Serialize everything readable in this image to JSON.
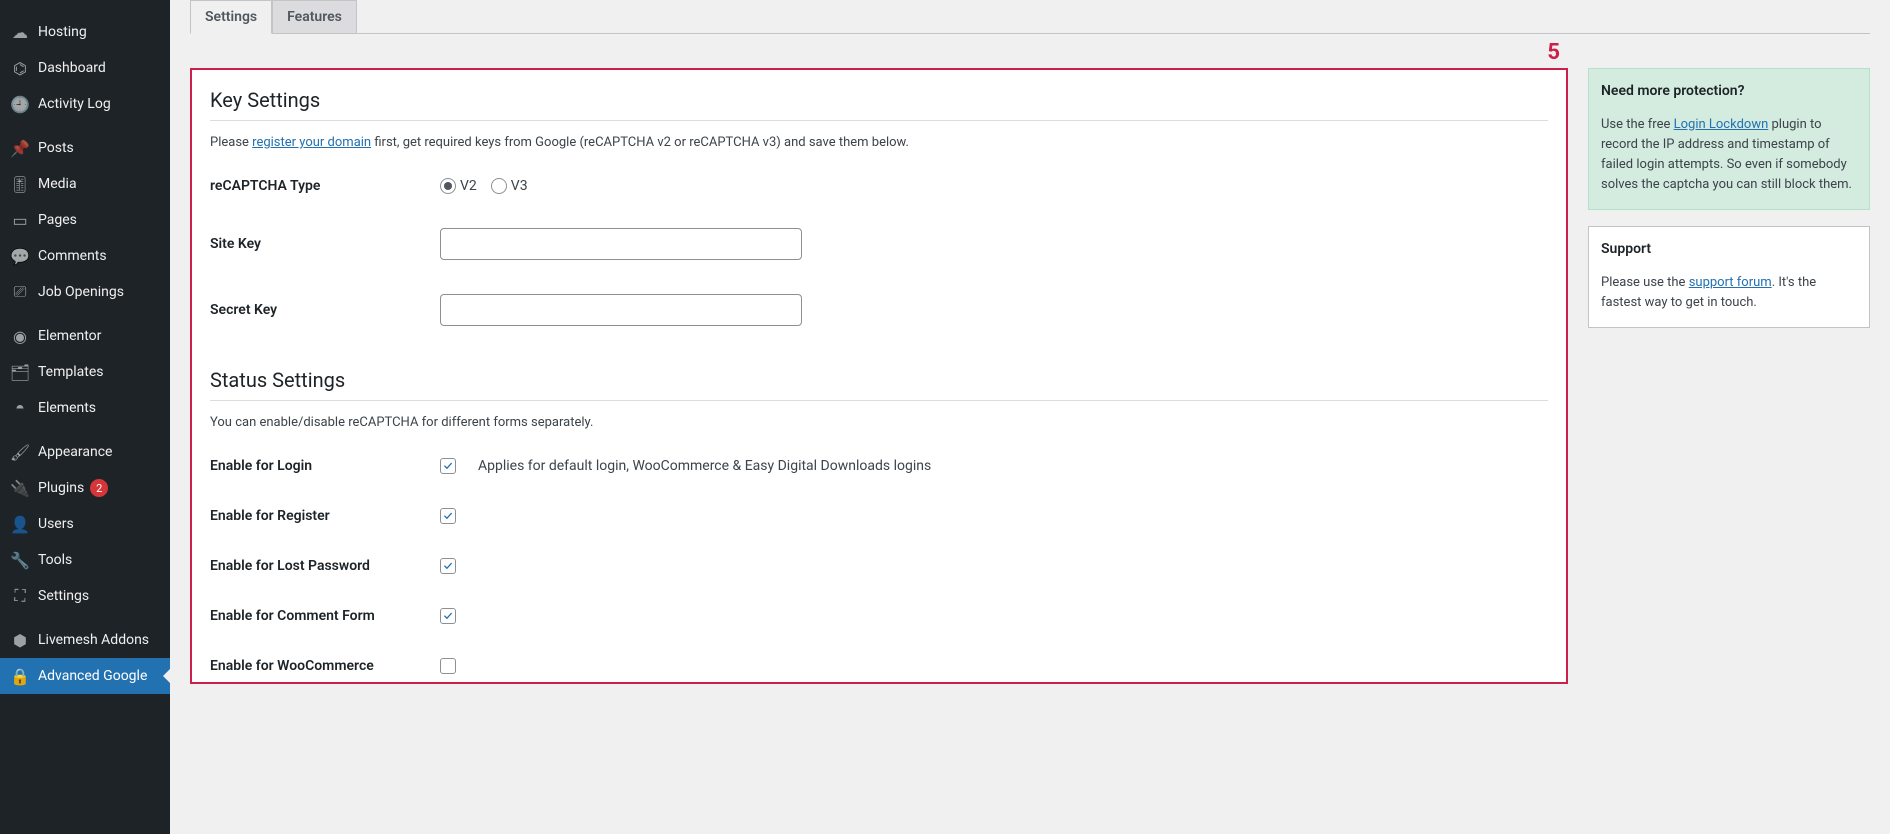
{
  "sidebar": {
    "items": [
      {
        "icon": "cloud-icon",
        "glyph": "☁",
        "label": "Hosting"
      },
      {
        "icon": "dashboard-icon",
        "glyph": "⌬",
        "label": "Dashboard"
      },
      {
        "icon": "clock-icon",
        "glyph": "🕘",
        "label": "Activity Log"
      },
      {
        "sep": true
      },
      {
        "icon": "pin-icon",
        "glyph": "📌",
        "label": "Posts"
      },
      {
        "icon": "media-icon",
        "glyph": "🎚",
        "label": "Media"
      },
      {
        "icon": "page-icon",
        "glyph": "▭",
        "label": "Pages"
      },
      {
        "icon": "comment-icon",
        "glyph": "💬",
        "label": "Comments"
      },
      {
        "icon": "briefcase-icon",
        "glyph": "⎚",
        "label": "Job Openings"
      },
      {
        "sep": true
      },
      {
        "icon": "elementor-icon",
        "glyph": "◉",
        "label": "Elementor"
      },
      {
        "icon": "folder-icon",
        "glyph": "🗂",
        "label": "Templates"
      },
      {
        "icon": "elements-icon",
        "glyph": "◓",
        "label": "Elements"
      },
      {
        "sep": true
      },
      {
        "icon": "brush-icon",
        "glyph": "🖌",
        "label": "Appearance"
      },
      {
        "icon": "plug-icon",
        "glyph": "🔌",
        "label": "Plugins",
        "badge": "2"
      },
      {
        "icon": "user-icon",
        "glyph": "👤",
        "label": "Users"
      },
      {
        "icon": "wrench-icon",
        "glyph": "🔧",
        "label": "Tools"
      },
      {
        "icon": "sliders-icon",
        "glyph": "⛶",
        "label": "Settings"
      },
      {
        "sep": true
      },
      {
        "icon": "cube-icon",
        "glyph": "⬢",
        "label": "Livemesh Addons"
      },
      {
        "icon": "lock-icon",
        "glyph": "🔒",
        "label": "Advanced Google",
        "active": true
      }
    ]
  },
  "tabs": {
    "settings": "Settings",
    "features": "Features"
  },
  "step": "5",
  "keySettings": {
    "title": "Key Settings",
    "desc_a": "Please ",
    "desc_link": "register your domain",
    "desc_b": " first, get required keys from Google (reCAPTCHA v2 or reCAPTCHA v3) and save them below.",
    "type_label": "reCAPTCHA Type",
    "v2": "V2",
    "v3": "V3",
    "site_key_label": "Site Key",
    "site_key_value": "",
    "secret_key_label": "Secret Key",
    "secret_key_value": ""
  },
  "statusSettings": {
    "title": "Status Settings",
    "desc": "You can enable/disable reCAPTCHA for different forms separately.",
    "rows": [
      {
        "label": "Enable for Login",
        "checked": true,
        "note": "Applies for default login, WooCommerce & Easy Digital Downloads logins"
      },
      {
        "label": "Enable for Register",
        "checked": true
      },
      {
        "label": "Enable for Lost Password",
        "checked": true
      },
      {
        "label": "Enable for Comment Form",
        "checked": true
      },
      {
        "label": "Enable for WooCommerce",
        "checked": false
      }
    ]
  },
  "aside": {
    "protect": {
      "title": "Need more protection?",
      "a": "Use the free ",
      "link": "Login Lockdown",
      "b": " plugin to record the IP address and timestamp of failed login attempts. So even if somebody solves the captcha you can still block them."
    },
    "support": {
      "title": "Support",
      "a": "Please use the ",
      "link": "support forum",
      "b": ". It's the fastest way to get in touch."
    }
  }
}
